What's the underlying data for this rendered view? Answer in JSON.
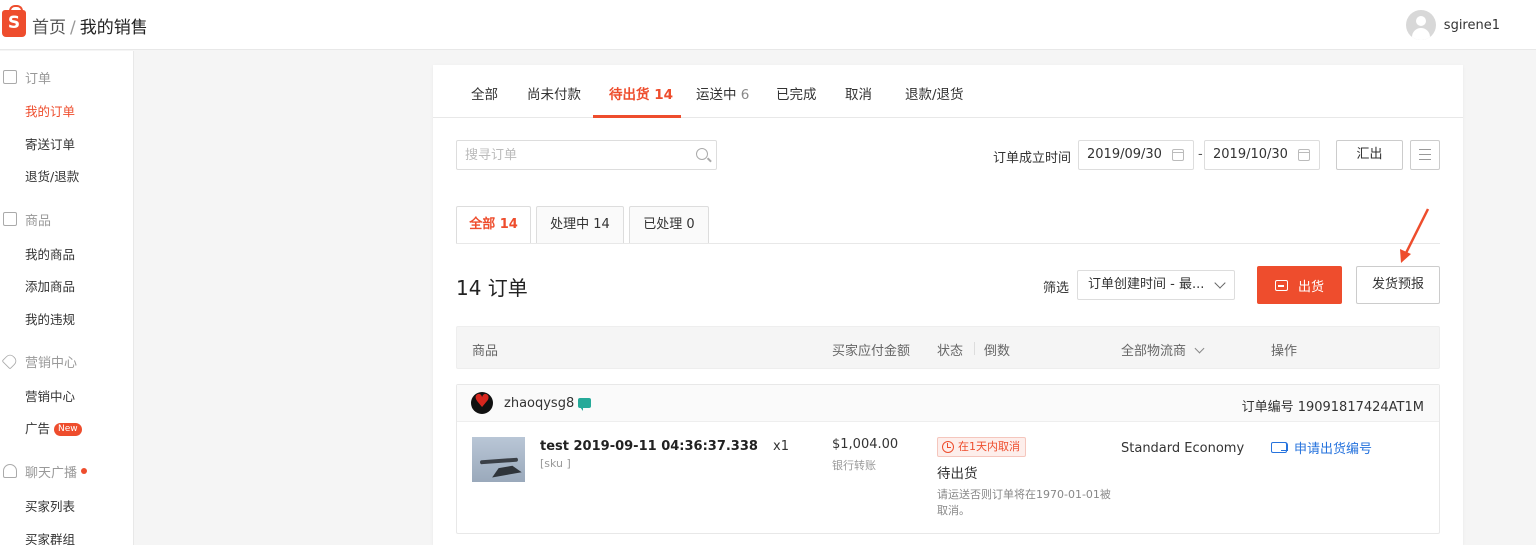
{
  "header": {
    "logo_text": "S",
    "breadcrumb_home": "首页",
    "breadcrumb_sep": "/",
    "breadcrumb_current": "我的销售",
    "username": "sgirene1"
  },
  "sidebar": {
    "groups": [
      {
        "label": "订单",
        "icon": "clipboard-icon",
        "items": [
          {
            "label": "我的订单",
            "active": true
          },
          {
            "label": "寄送订单"
          },
          {
            "label": "退货/退款"
          }
        ]
      },
      {
        "label": "商品",
        "icon": "bag-icon",
        "items": [
          {
            "label": "我的商品"
          },
          {
            "label": "添加商品"
          },
          {
            "label": "我的违规"
          }
        ]
      },
      {
        "label": "营销中心",
        "icon": "tag-icon",
        "items": [
          {
            "label": "营销中心"
          },
          {
            "label": "广告",
            "badge": "New"
          }
        ]
      },
      {
        "label": "聊天广播",
        "icon": "person-icon",
        "items": [
          {
            "label": "买家列表"
          },
          {
            "label": "买家群组"
          }
        ]
      }
    ]
  },
  "tabs": [
    {
      "label": "全部",
      "count": ""
    },
    {
      "label": "尚未付款",
      "count": ""
    },
    {
      "label": "待出货",
      "count": "14",
      "active": true
    },
    {
      "label": "运送中",
      "count": "6"
    },
    {
      "label": "已完成",
      "count": ""
    },
    {
      "label": "取消",
      "count": ""
    },
    {
      "label": "退款/退货",
      "count": ""
    }
  ],
  "search": {
    "placeholder": "搜寻订单"
  },
  "date_filter": {
    "label": "订单成立时间",
    "from": "2019/09/30",
    "to": "2019/10/30",
    "dash": "-"
  },
  "export_label": "汇出",
  "subtabs": [
    {
      "label": "全部 14",
      "active": true
    },
    {
      "label": "处理中 14"
    },
    {
      "label": "已处理 0"
    }
  ],
  "order_count": "14 订单",
  "filter": {
    "label": "筛选",
    "selected": "订单创建时间 - 最..."
  },
  "ship_button": "出货",
  "forecast_button": "发货预报",
  "accent_color": "#ee4d2d",
  "table_headers": {
    "product": "商品",
    "amount": "买家应付金额",
    "status": "状态",
    "countdown": "倒数",
    "carrier": "全部物流商",
    "action": "操作"
  },
  "order": {
    "buyer": "zhaoqysg8",
    "order_no": "订单编号 19091817424AT1M",
    "product_name": "test 2019-09-11 04:36:37.338",
    "sku": "[sku ]",
    "qty": "x1",
    "price": "$1,004.00",
    "pay_method": "银行转账",
    "status_badge": "在1天内取消",
    "status": "待出货",
    "status_note": "请运送否则订单将在1970-01-01被取消。",
    "carrier": "Standard Economy",
    "action": "申请出货编号"
  }
}
